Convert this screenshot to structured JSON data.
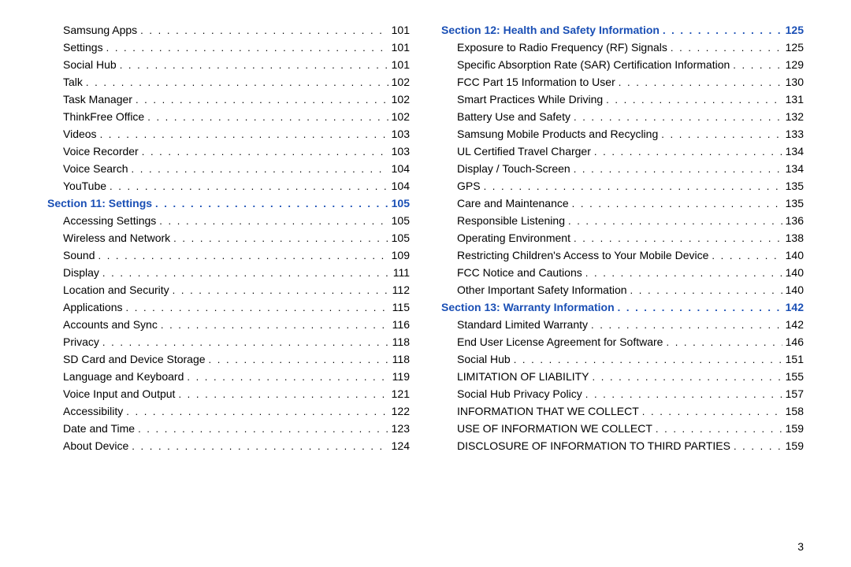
{
  "page_number": "3",
  "left_col": [
    {
      "type": "sub",
      "label": "Samsung Apps",
      "page": "101"
    },
    {
      "type": "sub",
      "label": "Settings",
      "page": "101"
    },
    {
      "type": "sub",
      "label": "Social Hub",
      "page": "101"
    },
    {
      "type": "sub",
      "label": "Talk",
      "page": "102"
    },
    {
      "type": "sub",
      "label": "Task Manager",
      "page": "102"
    },
    {
      "type": "sub",
      "label": "ThinkFree Office",
      "page": "102"
    },
    {
      "type": "sub",
      "label": "Videos",
      "page": "103"
    },
    {
      "type": "sub",
      "label": "Voice Recorder",
      "page": "103"
    },
    {
      "type": "sub",
      "label": "Voice Search",
      "page": "104"
    },
    {
      "type": "sub",
      "label": "YouTube",
      "page": "104"
    },
    {
      "type": "section",
      "label": "Section 11:  Settings",
      "page": "105"
    },
    {
      "type": "sub",
      "label": "Accessing Settings",
      "page": "105"
    },
    {
      "type": "sub",
      "label": "Wireless and Network",
      "page": "105"
    },
    {
      "type": "sub",
      "label": "Sound",
      "page": "109"
    },
    {
      "type": "sub",
      "label": "Display",
      "page": "111"
    },
    {
      "type": "sub",
      "label": "Location and Security",
      "page": "112"
    },
    {
      "type": "sub",
      "label": "Applications",
      "page": "115"
    },
    {
      "type": "sub",
      "label": "Accounts and Sync",
      "page": "116"
    },
    {
      "type": "sub",
      "label": "Privacy",
      "page": "118"
    },
    {
      "type": "sub",
      "label": "SD Card and Device Storage",
      "page": "118"
    },
    {
      "type": "sub",
      "label": "Language and Keyboard",
      "page": "119"
    },
    {
      "type": "sub",
      "label": "Voice Input and Output",
      "page": "121"
    },
    {
      "type": "sub",
      "label": "Accessibility",
      "page": "122"
    },
    {
      "type": "sub",
      "label": "Date and Time",
      "page": "123"
    },
    {
      "type": "sub",
      "label": "About Device",
      "page": "124"
    }
  ],
  "right_col": [
    {
      "type": "section",
      "label": "Section 12:  Health and Safety Information",
      "page": "125"
    },
    {
      "type": "sub",
      "label": "Exposure to Radio Frequency (RF) Signals",
      "page": "125"
    },
    {
      "type": "sub",
      "label": "Specific Absorption Rate (SAR) Certification Information",
      "page": "129"
    },
    {
      "type": "sub",
      "label": "FCC Part 15 Information to User",
      "page": "130"
    },
    {
      "type": "sub",
      "label": "Smart Practices While Driving",
      "page": "131"
    },
    {
      "type": "sub",
      "label": "Battery Use and Safety",
      "page": "132"
    },
    {
      "type": "sub",
      "label": "Samsung Mobile Products and Recycling",
      "page": "133"
    },
    {
      "type": "sub",
      "label": "UL Certified Travel Charger",
      "page": "134"
    },
    {
      "type": "sub",
      "label": "Display / Touch-Screen",
      "page": "134"
    },
    {
      "type": "sub",
      "label": "GPS",
      "page": "135"
    },
    {
      "type": "sub",
      "label": "Care and Maintenance",
      "page": "135"
    },
    {
      "type": "sub",
      "label": "Responsible Listening",
      "page": "136"
    },
    {
      "type": "sub",
      "label": "Operating Environment",
      "page": "138"
    },
    {
      "type": "sub",
      "label": "Restricting Children's Access to Your Mobile Device",
      "page": "140"
    },
    {
      "type": "sub",
      "label": "FCC Notice and Cautions",
      "page": "140"
    },
    {
      "type": "sub",
      "label": "Other Important Safety Information",
      "page": "140"
    },
    {
      "type": "section",
      "label": "Section 13:  Warranty Information",
      "page": "142"
    },
    {
      "type": "sub",
      "label": "Standard Limited Warranty",
      "page": "142"
    },
    {
      "type": "sub",
      "label": "End User License Agreement for Software",
      "page": "146"
    },
    {
      "type": "sub",
      "label": "Social Hub",
      "page": "151"
    },
    {
      "type": "sub",
      "label": "LIMITATION OF LIABILITY",
      "page": "155"
    },
    {
      "type": "sub",
      "label": "Social Hub Privacy Policy",
      "page": "157"
    },
    {
      "type": "sub",
      "label": "INFORMATION THAT WE COLLECT",
      "page": "158"
    },
    {
      "type": "sub",
      "label": "USE OF INFORMATION WE COLLECT",
      "page": "159"
    },
    {
      "type": "sub",
      "label": "DISCLOSURE OF INFORMATION TO THIRD PARTIES",
      "page": "159"
    }
  ]
}
